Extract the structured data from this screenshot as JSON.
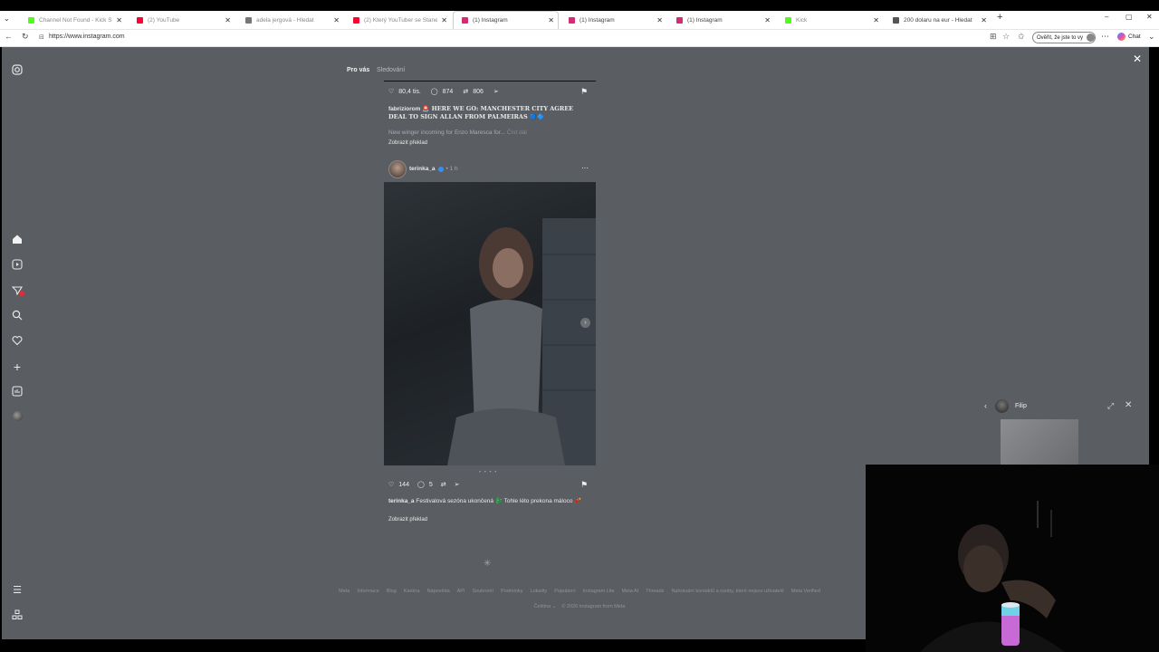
{
  "browser": {
    "tabs": [
      {
        "title": "Channel Not Found - Kick Stream",
        "favicon_color": "#53fc18"
      },
      {
        "title": "(2) YouTube",
        "favicon_color": "#ff0033"
      },
      {
        "title": "adela jergová - Hledat",
        "favicon_color": "#777777"
      },
      {
        "title": "(2) Který YouTuber se Stane Králem",
        "favicon_color": "#ff0033"
      },
      {
        "title": "(1) Instagram",
        "favicon_color": "#d62976"
      },
      {
        "title": "(1) Instagram",
        "favicon_color": "#d62976"
      },
      {
        "title": "(1) Instagram",
        "favicon_color": "#d62976"
      },
      {
        "title": "Kick",
        "favicon_color": "#53fc18"
      },
      {
        "title": "200 dolaru na eur - Hledat",
        "favicon_color": "#555555"
      }
    ],
    "url": "https://www.instagram.com",
    "verify_label": "Ověřit, že jste to vy",
    "copilot_label": "Chat"
  },
  "feed": {
    "tab_for_you": "Pro vás",
    "tab_following": "Sledování"
  },
  "post1": {
    "likes": "80,4 tis.",
    "comments": "874",
    "reposts": "806",
    "username": "fabriziorom",
    "caption": "🚨 HERE WE GO: MANCHESTER CITY AGREE DEAL TO SIGN ALLAN FROM PALMEIRAS 🔵🔷 ",
    "subtext": "New winger incoming for Enzo Maresca for...",
    "more": "Číst dál",
    "translate": "Zobrazit překlad"
  },
  "post2": {
    "username": "terinka_a",
    "time": "• 1 h",
    "likes": "144",
    "comments": "5",
    "username_caption": "terinka_a",
    "caption": "Festivalová sezóna ukončená 🐉 Tohle léto prekona máloco 🧨",
    "translate": "Zobrazit překlad"
  },
  "footer": {
    "links": [
      "Meta",
      "Informace",
      "Blog",
      "Kariéra",
      "Nápověda",
      "API",
      "Soukromí",
      "Podmínky",
      "Lokality",
      "Populární",
      "Instagram Lite",
      "Meta AI",
      "Threads",
      "Nahrávání kontaktů a osoby, které nejsou uživatelé",
      "Meta Verified"
    ],
    "language": "Čeština",
    "copyright": "© 2026 Instagram from Meta"
  },
  "chat": {
    "name": "Filip"
  }
}
